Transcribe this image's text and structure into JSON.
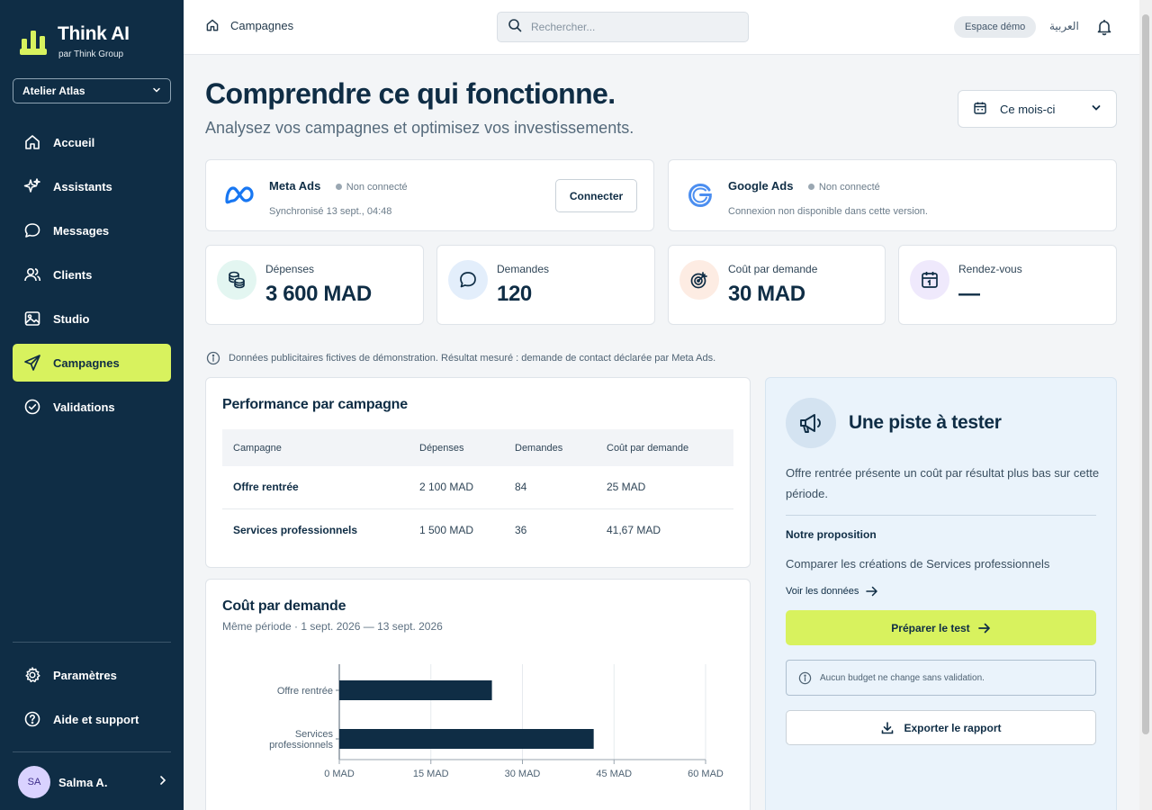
{
  "brand": {
    "name": "Think AI",
    "subtitle": "par Think Group"
  },
  "workspace": {
    "selected": "Atelier Atlas"
  },
  "nav": {
    "items": [
      {
        "label": "Accueil",
        "icon": "home-icon"
      },
      {
        "label": "Assistants",
        "icon": "sparkles-icon"
      },
      {
        "label": "Messages",
        "icon": "message-icon"
      },
      {
        "label": "Clients",
        "icon": "users-icon"
      },
      {
        "label": "Studio",
        "icon": "image-icon"
      },
      {
        "label": "Campagnes",
        "icon": "send-icon",
        "active": true
      },
      {
        "label": "Validations",
        "icon": "check-circle-icon"
      }
    ],
    "bottom": [
      {
        "label": "Paramètres",
        "icon": "gear-icon"
      },
      {
        "label": "Aide et support",
        "icon": "help-icon"
      }
    ]
  },
  "user": {
    "initials": "SA",
    "name": "Salma A."
  },
  "topbar": {
    "breadcrumb": "Campagnes",
    "search_placeholder": "Rechercher...",
    "demo_badge": "Espace démo",
    "language": "العربية"
  },
  "page": {
    "title": "Comprendre ce qui fonctionne.",
    "subtitle": "Analysez vos campagnes et optimisez vos investissements.",
    "period": "Ce mois-ci"
  },
  "connections": [
    {
      "name": "Meta Ads",
      "status": "Non connecté",
      "meta": "Synchronisé 13 sept., 04:48",
      "action": "Connecter"
    },
    {
      "name": "Google Ads",
      "status": "Non connecté",
      "meta": "Connexion non disponible dans cette version."
    }
  ],
  "kpis": [
    {
      "label": "Dépenses",
      "value": "3 600 MAD",
      "icon": "coins-icon",
      "color": "#e3f6f1"
    },
    {
      "label": "Demandes",
      "value": "120",
      "icon": "chat-icon",
      "color": "#e3eefb"
    },
    {
      "label": "Coût par demande",
      "value": "30 MAD",
      "icon": "target-icon",
      "color": "#fdece3"
    },
    {
      "label": "Rendez-vous",
      "value": "—",
      "icon": "calendar-icon",
      "color": "#efe9fc"
    }
  ],
  "note": "Données publicitaires fictives de démonstration. Résultat mesuré : demande de contact déclarée par Meta Ads.",
  "performance": {
    "title": "Performance par campagne",
    "columns": [
      "Campagne",
      "Dépenses",
      "Demandes",
      "Coût par demande"
    ],
    "rows": [
      [
        "Offre rentrée",
        "2 100 MAD",
        "84",
        "25 MAD"
      ],
      [
        "Services professionnels",
        "1 500 MAD",
        "36",
        "41,67 MAD"
      ]
    ]
  },
  "cost_chart": {
    "title": "Coût par demande",
    "subtitle": "Même période · 1 sept. 2026 — 13 sept. 2026"
  },
  "chart_data": {
    "type": "bar",
    "orientation": "horizontal",
    "categories": [
      "Offre rentrée",
      "Services professionnels"
    ],
    "values": [
      25,
      41.67
    ],
    "xlim": [
      0,
      60
    ],
    "ticks": [
      "0 MAD",
      "15 MAD",
      "30 MAD",
      "45 MAD",
      "60 MAD"
    ],
    "tick_values": [
      0,
      15,
      30,
      45,
      60
    ],
    "bar_color": "#0f2d45",
    "grid": true
  },
  "insight": {
    "title": "Une piste à tester",
    "text": "Offre rentrée présente un coût par résultat plus bas sur cette période.",
    "proposal_heading": "Notre proposition",
    "proposal": "Comparer les créations de Services professionnels",
    "link": "Voir les données",
    "primary_button": "Préparer le test",
    "info": "Aucun budget ne change sans validation.",
    "export_button": "Exporter le rapport"
  },
  "colors": {
    "sidebar": "#0f2d45",
    "accent": "#d8f25e",
    "panel": "#eaf3fb"
  }
}
